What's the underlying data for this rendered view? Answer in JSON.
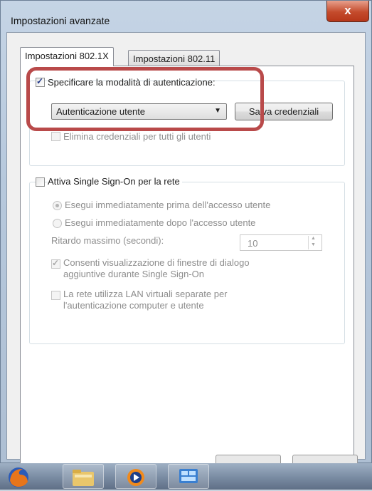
{
  "window": {
    "title": "Impostazioni avanzate",
    "close_label": "x"
  },
  "tabs": [
    {
      "label": "Impostazioni 802.1X",
      "active": true
    },
    {
      "label": "Impostazioni 802.11",
      "active": false
    }
  ],
  "auth": {
    "specify_mode_label": "Specificare la modalità di autenticazione:",
    "specify_mode_checked": true,
    "mode_value": "Autenticazione utente",
    "save_credentials_label": "Salva credenziali",
    "delete_credentials_label": "Elimina credenziali per tutti gli utenti",
    "delete_credentials_checked": false
  },
  "sso": {
    "enable_label": "Attiva Single Sign-On per la rete",
    "enable_checked": false,
    "before_logon_label": "Esegui immediatamente prima dell'accesso utente",
    "after_logon_label": "Esegui immediatamente dopo l'accesso utente",
    "max_delay_label": "Ritardo massimo (secondi):",
    "max_delay_value": "10",
    "allow_dialogs_label_line1": "Consenti visualizzazione di finestre di dialogo",
    "allow_dialogs_label_line2": "aggiuntive durante Single Sign-On",
    "allow_dialogs_checked": true,
    "vlan_label_line1": "La rete utilizza LAN virtuali separate per",
    "vlan_label_line2": "l'autenticazione computer e utente",
    "vlan_checked": false
  },
  "colors": {
    "highlight": "#b94a4a",
    "close_button": "#c44b2c",
    "taskbar": "#7c8ea5"
  },
  "taskbar": {
    "icons": [
      "firefox-icon",
      "folder-icon",
      "media-player-icon",
      "network-icon"
    ]
  }
}
